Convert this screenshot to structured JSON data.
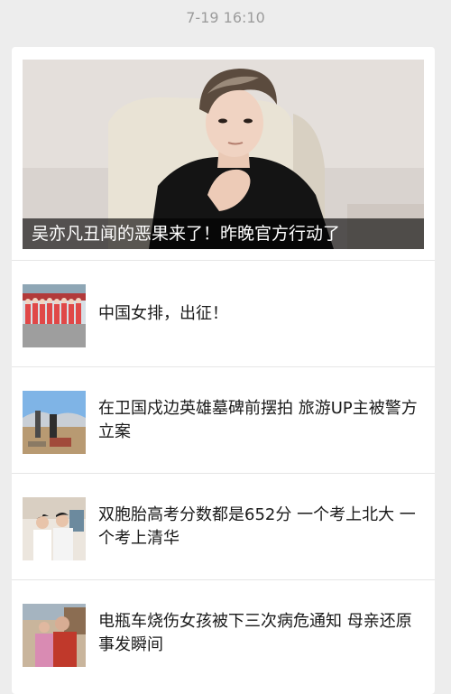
{
  "timestamp": "7-19 16:10",
  "hero": {
    "title": "吴亦凡丑闻的恶果来了！昨晚官方行动了"
  },
  "articles": [
    {
      "title": "中国女排，出征！",
      "thumbnail": "volleyball-team-photo"
    },
    {
      "title": "在卫国戍边英雄墓碑前摆拍 旅游UP主被警方立案",
      "thumbnail": "memorial-monument-photo"
    },
    {
      "title": "双胞胎高考分数都是652分 一个考上北大 一个考上清华",
      "thumbnail": "twins-photo"
    },
    {
      "title": "电瓶车烧伤女孩被下三次病危通知 母亲还原事发瞬间",
      "thumbnail": "mother-daughter-photo"
    }
  ]
}
